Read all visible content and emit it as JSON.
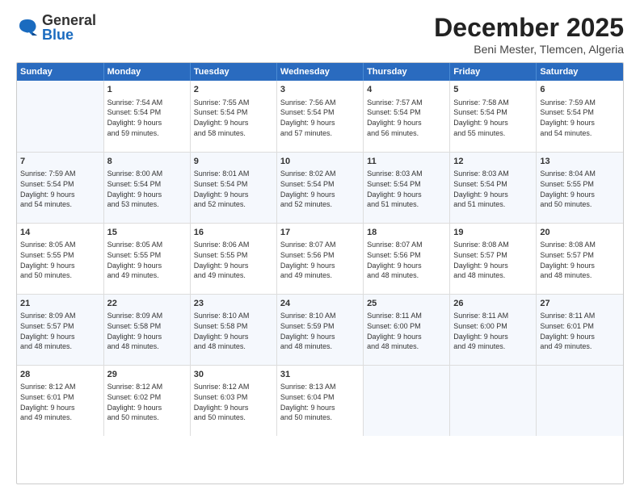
{
  "header": {
    "logo_general": "General",
    "logo_blue": "Blue",
    "month_year": "December 2025",
    "location": "Beni Mester, Tlemcen, Algeria"
  },
  "days_of_week": [
    "Sunday",
    "Monday",
    "Tuesday",
    "Wednesday",
    "Thursday",
    "Friday",
    "Saturday"
  ],
  "weeks": [
    [
      {
        "day": "",
        "info": ""
      },
      {
        "day": "1",
        "info": "Sunrise: 7:54 AM\nSunset: 5:54 PM\nDaylight: 9 hours\nand 59 minutes."
      },
      {
        "day": "2",
        "info": "Sunrise: 7:55 AM\nSunset: 5:54 PM\nDaylight: 9 hours\nand 58 minutes."
      },
      {
        "day": "3",
        "info": "Sunrise: 7:56 AM\nSunset: 5:54 PM\nDaylight: 9 hours\nand 57 minutes."
      },
      {
        "day": "4",
        "info": "Sunrise: 7:57 AM\nSunset: 5:54 PM\nDaylight: 9 hours\nand 56 minutes."
      },
      {
        "day": "5",
        "info": "Sunrise: 7:58 AM\nSunset: 5:54 PM\nDaylight: 9 hours\nand 55 minutes."
      },
      {
        "day": "6",
        "info": "Sunrise: 7:59 AM\nSunset: 5:54 PM\nDaylight: 9 hours\nand 54 minutes."
      }
    ],
    [
      {
        "day": "7",
        "info": "Sunrise: 7:59 AM\nSunset: 5:54 PM\nDaylight: 9 hours\nand 54 minutes."
      },
      {
        "day": "8",
        "info": "Sunrise: 8:00 AM\nSunset: 5:54 PM\nDaylight: 9 hours\nand 53 minutes."
      },
      {
        "day": "9",
        "info": "Sunrise: 8:01 AM\nSunset: 5:54 PM\nDaylight: 9 hours\nand 52 minutes."
      },
      {
        "day": "10",
        "info": "Sunrise: 8:02 AM\nSunset: 5:54 PM\nDaylight: 9 hours\nand 52 minutes."
      },
      {
        "day": "11",
        "info": "Sunrise: 8:03 AM\nSunset: 5:54 PM\nDaylight: 9 hours\nand 51 minutes."
      },
      {
        "day": "12",
        "info": "Sunrise: 8:03 AM\nSunset: 5:54 PM\nDaylight: 9 hours\nand 51 minutes."
      },
      {
        "day": "13",
        "info": "Sunrise: 8:04 AM\nSunset: 5:55 PM\nDaylight: 9 hours\nand 50 minutes."
      }
    ],
    [
      {
        "day": "14",
        "info": "Sunrise: 8:05 AM\nSunset: 5:55 PM\nDaylight: 9 hours\nand 50 minutes."
      },
      {
        "day": "15",
        "info": "Sunrise: 8:05 AM\nSunset: 5:55 PM\nDaylight: 9 hours\nand 49 minutes."
      },
      {
        "day": "16",
        "info": "Sunrise: 8:06 AM\nSunset: 5:55 PM\nDaylight: 9 hours\nand 49 minutes."
      },
      {
        "day": "17",
        "info": "Sunrise: 8:07 AM\nSunset: 5:56 PM\nDaylight: 9 hours\nand 49 minutes."
      },
      {
        "day": "18",
        "info": "Sunrise: 8:07 AM\nSunset: 5:56 PM\nDaylight: 9 hours\nand 48 minutes."
      },
      {
        "day": "19",
        "info": "Sunrise: 8:08 AM\nSunset: 5:57 PM\nDaylight: 9 hours\nand 48 minutes."
      },
      {
        "day": "20",
        "info": "Sunrise: 8:08 AM\nSunset: 5:57 PM\nDaylight: 9 hours\nand 48 minutes."
      }
    ],
    [
      {
        "day": "21",
        "info": "Sunrise: 8:09 AM\nSunset: 5:57 PM\nDaylight: 9 hours\nand 48 minutes."
      },
      {
        "day": "22",
        "info": "Sunrise: 8:09 AM\nSunset: 5:58 PM\nDaylight: 9 hours\nand 48 minutes."
      },
      {
        "day": "23",
        "info": "Sunrise: 8:10 AM\nSunset: 5:58 PM\nDaylight: 9 hours\nand 48 minutes."
      },
      {
        "day": "24",
        "info": "Sunrise: 8:10 AM\nSunset: 5:59 PM\nDaylight: 9 hours\nand 48 minutes."
      },
      {
        "day": "25",
        "info": "Sunrise: 8:11 AM\nSunset: 6:00 PM\nDaylight: 9 hours\nand 48 minutes."
      },
      {
        "day": "26",
        "info": "Sunrise: 8:11 AM\nSunset: 6:00 PM\nDaylight: 9 hours\nand 49 minutes."
      },
      {
        "day": "27",
        "info": "Sunrise: 8:11 AM\nSunset: 6:01 PM\nDaylight: 9 hours\nand 49 minutes."
      }
    ],
    [
      {
        "day": "28",
        "info": "Sunrise: 8:12 AM\nSunset: 6:01 PM\nDaylight: 9 hours\nand 49 minutes."
      },
      {
        "day": "29",
        "info": "Sunrise: 8:12 AM\nSunset: 6:02 PM\nDaylight: 9 hours\nand 50 minutes."
      },
      {
        "day": "30",
        "info": "Sunrise: 8:12 AM\nSunset: 6:03 PM\nDaylight: 9 hours\nand 50 minutes."
      },
      {
        "day": "31",
        "info": "Sunrise: 8:13 AM\nSunset: 6:04 PM\nDaylight: 9 hours\nand 50 minutes."
      },
      {
        "day": "",
        "info": ""
      },
      {
        "day": "",
        "info": ""
      },
      {
        "day": "",
        "info": ""
      }
    ]
  ]
}
